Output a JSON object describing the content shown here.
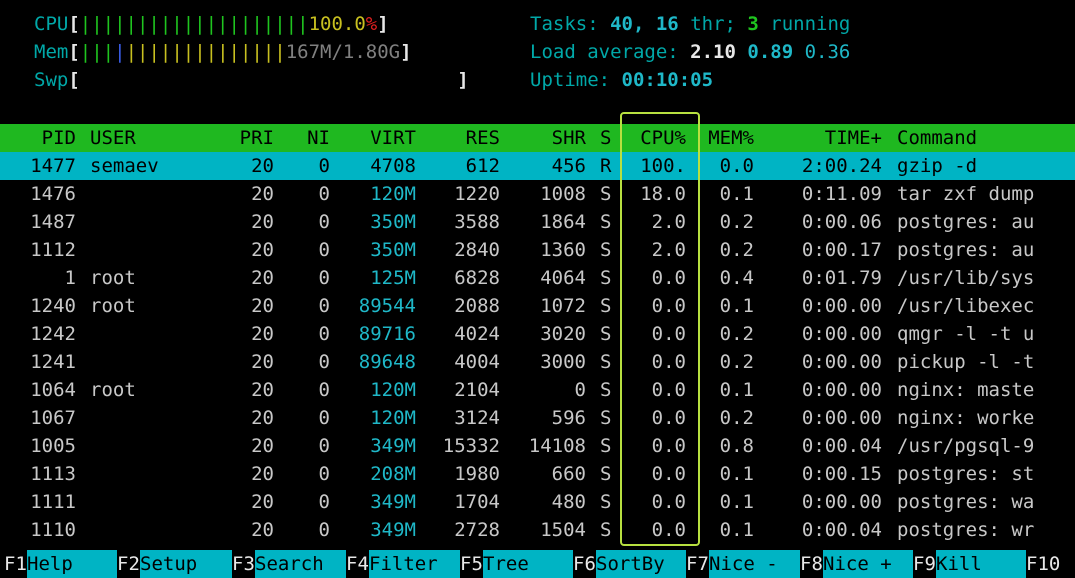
{
  "meters": {
    "cpu": {
      "label": "CPU",
      "bars": "||||||||||||||||||||",
      "value": "100.0",
      "pct": "%"
    },
    "mem": {
      "label": "Mem",
      "bars_green": "|||",
      "bars_blue": "|",
      "bars_yellow": "||||||||||||||",
      "value": "167M/1.80G"
    },
    "swp": {
      "label": "Swp"
    }
  },
  "sysinfo": {
    "tasks_label": "Tasks: ",
    "tasks": "40",
    "thr": "16",
    "thr_label": " thr; ",
    "running": "3",
    "running_label": " running",
    "load_label": "Load average: ",
    "load1": "2.10",
    "load5": "0.89",
    "load15": "0.36",
    "uptime_label": "Uptime: ",
    "uptime": "00:10:05"
  },
  "columns": {
    "pid": "PID",
    "user": "USER",
    "pri": "PRI",
    "ni": "NI",
    "virt": "VIRT",
    "res": "RES",
    "shr": "SHR",
    "s": "S",
    "cpu": "CPU%",
    "mem": "MEM%",
    "time": "TIME+",
    "cmd": "Command"
  },
  "processes": [
    {
      "pid": "1477",
      "user": "semaev",
      "pri": "20",
      "ni": "0",
      "virt": "4708",
      "res": "612",
      "shr": "456",
      "s": "R",
      "cpu": "100.",
      "mem": "0.0",
      "time": "2:00.24",
      "cmd": "gzip -d"
    },
    {
      "pid": "1476",
      "user": "",
      "pri": "20",
      "ni": "0",
      "virt": "120M",
      "res": "1220",
      "shr": "1008",
      "s": "S",
      "cpu": "18.0",
      "mem": "0.1",
      "time": "0:11.09",
      "cmd": "tar zxf dump"
    },
    {
      "pid": "1487",
      "user": "",
      "pri": "20",
      "ni": "0",
      "virt": "350M",
      "res": "3588",
      "shr": "1864",
      "s": "S",
      "cpu": "2.0",
      "mem": "0.2",
      "time": "0:00.06",
      "cmd": "postgres: au"
    },
    {
      "pid": "1112",
      "user": "",
      "pri": "20",
      "ni": "0",
      "virt": "350M",
      "res": "2840",
      "shr": "1360",
      "s": "S",
      "cpu": "2.0",
      "mem": "0.2",
      "time": "0:00.17",
      "cmd": "postgres: au"
    },
    {
      "pid": "1",
      "user": "root",
      "pri": "20",
      "ni": "0",
      "virt": "125M",
      "res": "6828",
      "shr": "4064",
      "s": "S",
      "cpu": "0.0",
      "mem": "0.4",
      "time": "0:01.79",
      "cmd": "/usr/lib/sys"
    },
    {
      "pid": "1240",
      "user": "root",
      "pri": "20",
      "ni": "0",
      "virt": "89544",
      "res": "2088",
      "shr": "1072",
      "s": "S",
      "cpu": "0.0",
      "mem": "0.1",
      "time": "0:00.00",
      "cmd": "/usr/libexec"
    },
    {
      "pid": "1242",
      "user": "",
      "pri": "20",
      "ni": "0",
      "virt": "89716",
      "res": "4024",
      "shr": "3020",
      "s": "S",
      "cpu": "0.0",
      "mem": "0.2",
      "time": "0:00.00",
      "cmd": "qmgr -l -t u"
    },
    {
      "pid": "1241",
      "user": "",
      "pri": "20",
      "ni": "0",
      "virt": "89648",
      "res": "4004",
      "shr": "3000",
      "s": "S",
      "cpu": "0.0",
      "mem": "0.2",
      "time": "0:00.00",
      "cmd": "pickup -l -t"
    },
    {
      "pid": "1064",
      "user": "root",
      "pri": "20",
      "ni": "0",
      "virt": "120M",
      "res": "2104",
      "shr": "0",
      "s": "S",
      "cpu": "0.0",
      "mem": "0.1",
      "time": "0:00.00",
      "cmd": "nginx: maste"
    },
    {
      "pid": "1067",
      "user": "",
      "pri": "20",
      "ni": "0",
      "virt": "120M",
      "res": "3124",
      "shr": "596",
      "s": "S",
      "cpu": "0.0",
      "mem": "0.2",
      "time": "0:00.00",
      "cmd": "nginx: worke"
    },
    {
      "pid": "1005",
      "user": "",
      "pri": "20",
      "ni": "0",
      "virt": "349M",
      "res": "15332",
      "shr": "14108",
      "s": "S",
      "cpu": "0.0",
      "mem": "0.8",
      "time": "0:00.04",
      "cmd": "/usr/pgsql-9"
    },
    {
      "pid": "1113",
      "user": "",
      "pri": "20",
      "ni": "0",
      "virt": "208M",
      "res": "1980",
      "shr": "660",
      "s": "S",
      "cpu": "0.0",
      "mem": "0.1",
      "time": "0:00.15",
      "cmd": "postgres: st"
    },
    {
      "pid": "1111",
      "user": "",
      "pri": "20",
      "ni": "0",
      "virt": "349M",
      "res": "1704",
      "shr": "480",
      "s": "S",
      "cpu": "0.0",
      "mem": "0.1",
      "time": "0:00.00",
      "cmd": "postgres: wa"
    },
    {
      "pid": "1110",
      "user": "",
      "pri": "20",
      "ni": "0",
      "virt": "349M",
      "res": "2728",
      "shr": "1504",
      "s": "S",
      "cpu": "0.0",
      "mem": "0.1",
      "time": "0:00.04",
      "cmd": "postgres: wr"
    }
  ],
  "footer": [
    {
      "key": "F1",
      "label": "Help"
    },
    {
      "key": "F2",
      "label": "Setup"
    },
    {
      "key": "F3",
      "label": "Search"
    },
    {
      "key": "F4",
      "label": "Filter"
    },
    {
      "key": "F5",
      "label": "Tree"
    },
    {
      "key": "F6",
      "label": "SortBy"
    },
    {
      "key": "F7",
      "label": "Nice -"
    },
    {
      "key": "F8",
      "label": "Nice +"
    },
    {
      "key": "F9",
      "label": "Kill"
    },
    {
      "key": "F10",
      "label": ""
    }
  ],
  "colors": {
    "header_bg": "#1fb820",
    "selected_bg": "#00b4c4",
    "highlight_border": "#b8e040"
  }
}
